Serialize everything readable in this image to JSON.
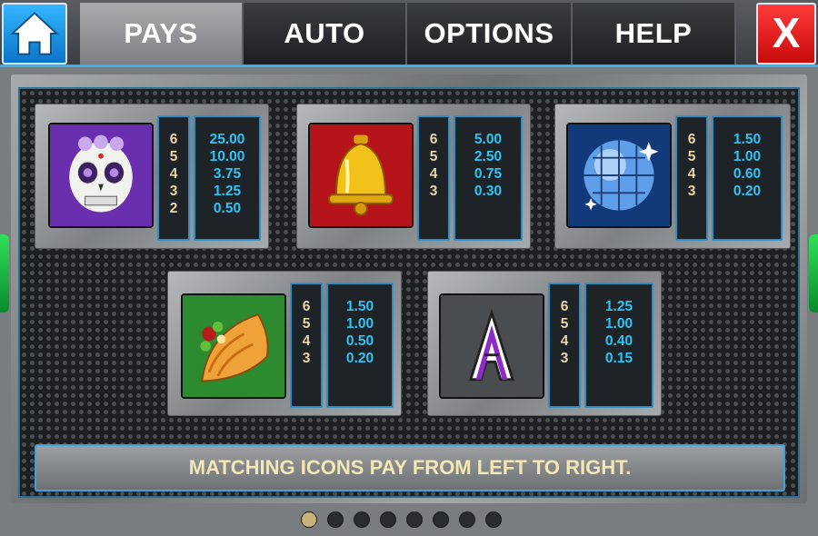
{
  "nav": {
    "home_icon": "home-icon",
    "tabs": [
      "PAYS",
      "AUTO",
      "OPTIONS",
      "HELP"
    ],
    "active_tab": "PAYS",
    "close_label": "X"
  },
  "paytable": [
    {
      "symbol": "sugar-skull",
      "counts": [
        "6",
        "5",
        "4",
        "3",
        "2"
      ],
      "pays": [
        "25.00",
        "10.00",
        "3.75",
        "1.25",
        "0.50"
      ]
    },
    {
      "symbol": "bell",
      "counts": [
        "6",
        "5",
        "4",
        "3"
      ],
      "pays": [
        "5.00",
        "2.50",
        "0.75",
        "0.30"
      ]
    },
    {
      "symbol": "disco-ball",
      "counts": [
        "6",
        "5",
        "4",
        "3"
      ],
      "pays": [
        "1.50",
        "1.00",
        "0.60",
        "0.20"
      ]
    },
    {
      "symbol": "taco",
      "counts": [
        "6",
        "5",
        "4",
        "3"
      ],
      "pays": [
        "1.50",
        "1.00",
        "0.50",
        "0.20"
      ]
    },
    {
      "symbol": "letter-a",
      "counts": [
        "6",
        "5",
        "4",
        "3"
      ],
      "pays": [
        "1.25",
        "1.00",
        "0.40",
        "0.15"
      ]
    }
  ],
  "note": "MATCHING ICONS PAY FROM LEFT TO RIGHT.",
  "pagination": {
    "total": 8,
    "current": 1
  },
  "colors": {
    "accent": "#36b2e8",
    "pay_value": "#2ec4f3",
    "count_value": "#e8d6a6",
    "close": "#e01414",
    "home": "#1a8ee0"
  }
}
